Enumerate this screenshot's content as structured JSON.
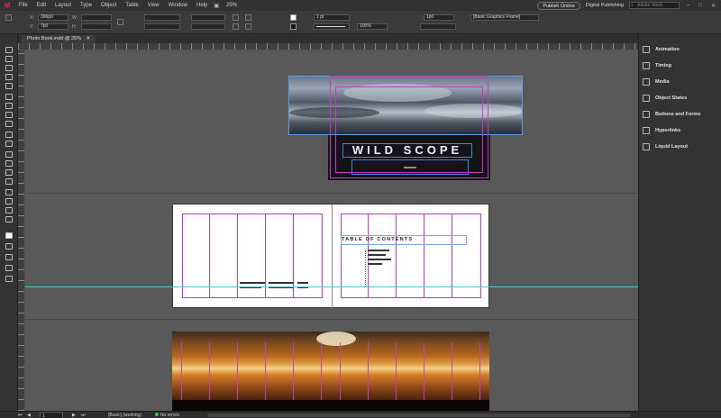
{
  "app": {
    "logo": "Id"
  },
  "menu": {
    "items": [
      "File",
      "Edit",
      "Layout",
      "Type",
      "Object",
      "Table",
      "View",
      "Window",
      "Help"
    ],
    "zoom": "25%",
    "publish_label": "Publish Online",
    "workspace": "Digital Publishing",
    "search_placeholder": "Adobe Stock"
  },
  "control": {
    "x_value": "396p0",
    "y_value": "7p0",
    "stroke_weight": "1 pt",
    "opacity": "100%",
    "gap_value": "1p0",
    "frame_style": "[Basic Graphics Frame]"
  },
  "document_tab": "Photo Book.indd @ 25%",
  "cover": {
    "title": "WILD SCOPE"
  },
  "toc": {
    "title": "TABLE OF CONTENTS"
  },
  "panels": {
    "items": [
      "Animation",
      "Timing",
      "Media",
      "Object States",
      "Buttons and Forms",
      "Hyperlinks",
      "Liquid Layout"
    ]
  },
  "status": {
    "page": "1",
    "style": "[Basic] (working)",
    "preflight": "No errors"
  }
}
